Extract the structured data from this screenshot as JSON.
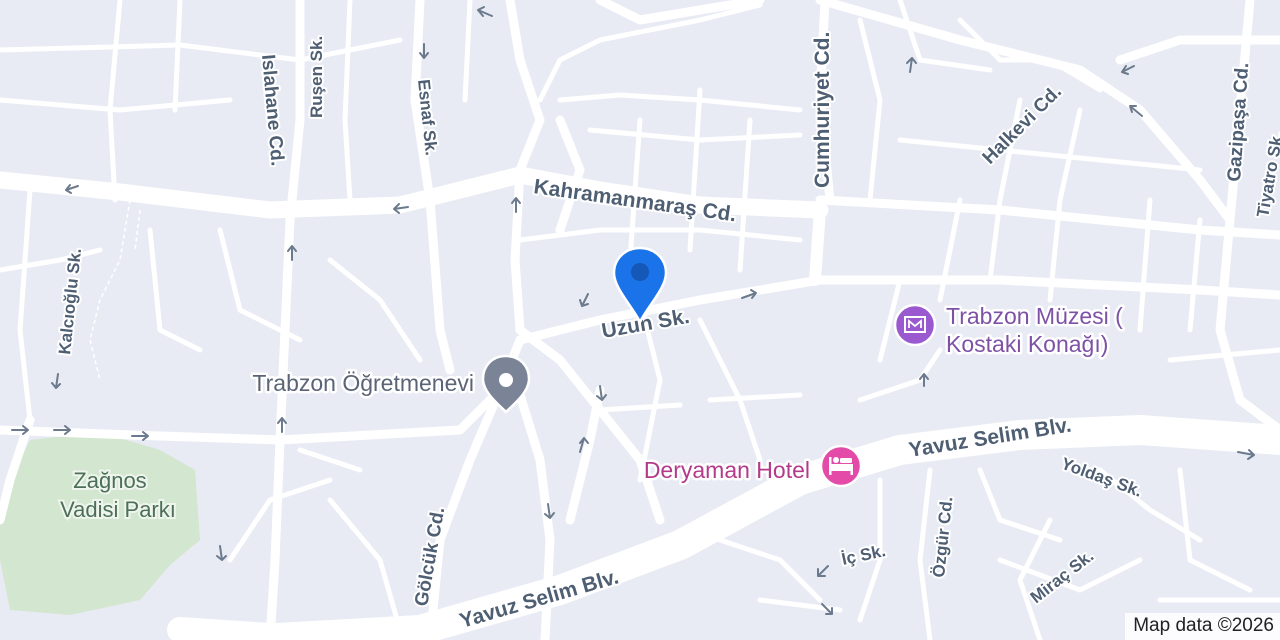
{
  "map": {
    "colors": {
      "background": "#e8ebf4",
      "road": "#ffffff",
      "park": "#d3e6cf",
      "pin": "#1a73e8",
      "museum": "#9b59d0",
      "hotel": "#e44aa8",
      "marker_gray": "#7b8496"
    },
    "streets": {
      "kahramanmaras": "Kahramanmaraş Cd.",
      "uzun": "Uzun Sk.",
      "cumhuriyet": "Cumhuriyet Cd.",
      "halkevi": "Halkevi Cd.",
      "gazipasa": "Gazipaşa Cd.",
      "tiyatro": "Tiyatro Sk.",
      "islahane": "Islahane Cd.",
      "rusen": "Ruşen Sk.",
      "esnaf": "Esnaf Sk.",
      "kalcioglu": "Kalcıoğlu Sk.",
      "golcuk": "Gölcük Cd.",
      "yavuz_selim_right": "Yavuz Selim Blv.",
      "yavuz_selim_left": "Yavuz Selim Blv.",
      "yoldas": "Yoldaş Sk.",
      "ozgur": "Özgür Cd.",
      "ic": "İç Sk.",
      "mirac": "Miraç Sk."
    },
    "pois": {
      "ogretmenevi": {
        "name": "Trabzon Öğretmenevi",
        "icon": "location-marker-icon"
      },
      "museum": {
        "name_line1": "Trabzon Müzesi (",
        "name_line2": "Kostaki Konağı)",
        "icon": "museum-icon"
      },
      "hotel": {
        "name": "Deryaman Hotel",
        "icon": "hotel-bed-icon"
      },
      "park": {
        "name_line1": "Zağnos",
        "name_line2": "Vadisi Parkı"
      }
    },
    "selected_pin": {
      "icon": "location-pin-icon"
    },
    "attribution": "Map data ©2026"
  }
}
